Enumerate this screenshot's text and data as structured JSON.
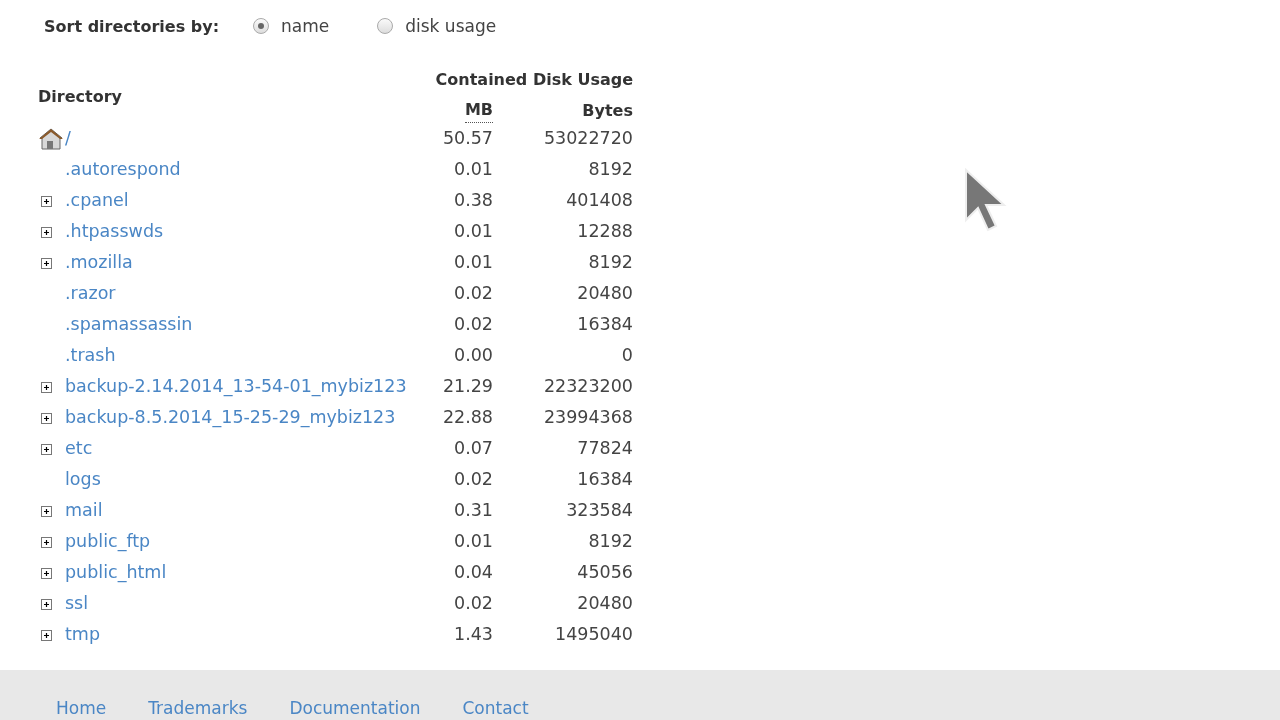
{
  "sort": {
    "label": "Sort directories by:",
    "options": [
      {
        "label": "name",
        "selected": true
      },
      {
        "label": "disk usage",
        "selected": false
      }
    ]
  },
  "table": {
    "columns": {
      "directory": "Directory",
      "group": "Contained Disk Usage",
      "mb": "MB",
      "bytes": "Bytes"
    },
    "rows": [
      {
        "kind": "home",
        "name": "/",
        "mb": "50.57",
        "bytes": "53022720"
      },
      {
        "kind": "folder",
        "name": ".autorespond",
        "mb": "0.01",
        "bytes": "8192",
        "expandable": false
      },
      {
        "kind": "folder",
        "name": ".cpanel",
        "mb": "0.38",
        "bytes": "401408",
        "expandable": true
      },
      {
        "kind": "folder",
        "name": ".htpasswds",
        "mb": "0.01",
        "bytes": "12288",
        "expandable": true
      },
      {
        "kind": "folder",
        "name": ".mozilla",
        "mb": "0.01",
        "bytes": "8192",
        "expandable": true
      },
      {
        "kind": "folder",
        "name": ".razor",
        "mb": "0.02",
        "bytes": "20480",
        "expandable": false
      },
      {
        "kind": "folder",
        "name": ".spamassassin",
        "mb": "0.02",
        "bytes": "16384",
        "expandable": false
      },
      {
        "kind": "folder",
        "name": ".trash",
        "mb": "0.00",
        "bytes": "0",
        "expandable": false
      },
      {
        "kind": "folder",
        "name": "backup-2.14.2014_13-54-01_mybiz123",
        "mb": "21.29",
        "bytes": "22323200",
        "expandable": true
      },
      {
        "kind": "folder",
        "name": "backup-8.5.2014_15-25-29_mybiz123",
        "mb": "22.88",
        "bytes": "23994368",
        "expandable": true
      },
      {
        "kind": "folder",
        "name": "etc",
        "mb": "0.07",
        "bytes": "77824",
        "expandable": true
      },
      {
        "kind": "folder",
        "name": "logs",
        "mb": "0.02",
        "bytes": "16384",
        "expandable": false
      },
      {
        "kind": "folder",
        "name": "mail",
        "mb": "0.31",
        "bytes": "323584",
        "expandable": true
      },
      {
        "kind": "folder",
        "name": "public_ftp",
        "mb": "0.01",
        "bytes": "8192",
        "expandable": true
      },
      {
        "kind": "folder",
        "name": "public_html",
        "mb": "0.04",
        "bytes": "45056",
        "expandable": true
      },
      {
        "kind": "folder",
        "name": "ssl",
        "mb": "0.02",
        "bytes": "20480",
        "expandable": true
      },
      {
        "kind": "folder",
        "name": "tmp",
        "mb": "1.43",
        "bytes": "1495040",
        "expandable": true
      }
    ]
  },
  "footer": {
    "links": [
      "Home",
      "Trademarks",
      "Documentation",
      "Contact"
    ]
  }
}
